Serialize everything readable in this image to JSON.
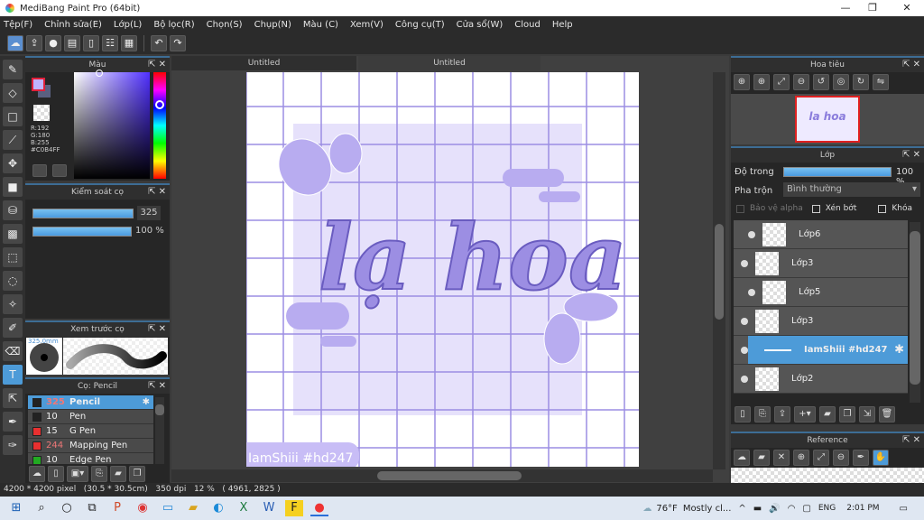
{
  "window": {
    "title": "MediBang Paint Pro (64bit)",
    "minimize": "—",
    "maximize": "❐",
    "close": "✕"
  },
  "menu": [
    "Tệp(F)",
    "Chỉnh sửa(E)",
    "Lớp(L)",
    "Bộ lọc(R)",
    "Chọn(S)",
    "Chụp(N)",
    "Màu (C)",
    "Xem(V)",
    "Công cụ(T)",
    "Cửa sổ(W)",
    "Cloud",
    "Help"
  ],
  "tabs": [
    "Untitled",
    "Untitled"
  ],
  "color_panel": {
    "title": "Màu",
    "r": "R:192",
    "g": "G:180",
    "b": "B:255",
    "hex": "#C0B4FF",
    "fg": "#c0b4ff",
    "bg": "#5a6080"
  },
  "brush_control": {
    "title": "Kiểm soát cọ",
    "size": "325",
    "opacity": "100 %"
  },
  "brush_preview": {
    "title": "Xem trước cọ",
    "size_label": "325.0mm"
  },
  "brush_list": {
    "title": "Cọ: Pencil",
    "items": [
      {
        "size": "325",
        "name": "Pencil",
        "color": "#222222",
        "selected": true
      },
      {
        "size": "10",
        "name": "Pen",
        "color": "#222222"
      },
      {
        "size": "15",
        "name": "G Pen",
        "color": "#e83030"
      },
      {
        "size": "244",
        "name": "Mapping Pen",
        "color": "#e83030"
      },
      {
        "size": "10",
        "name": "Edge Pen",
        "color": "#22aa22"
      }
    ]
  },
  "navigator": {
    "title": "Hoa tiêu"
  },
  "layers": {
    "title": "Lớp",
    "opacity_label": "Độ trong",
    "opacity": "100 %",
    "blend_label": "Pha trộn",
    "blend": "Bình thường",
    "protect_alpha": "Bảo vệ alpha",
    "clip": "Xén bớt",
    "lock": "Khóa",
    "items": [
      {
        "name": "Lớp6",
        "indent": true
      },
      {
        "name": "Lớp3"
      },
      {
        "name": "Lớp5",
        "indent": true
      },
      {
        "name": "Lớp3"
      },
      {
        "name": "IamShiii #hd247",
        "selected": true
      },
      {
        "name": "Lớp2"
      }
    ]
  },
  "reference": {
    "title": "Reference"
  },
  "canvas": {
    "art_text": "lạ hoa",
    "watermark": "IamShiii #hd247"
  },
  "status": "4200 * 4200 pixel   (30.5 * 30.5cm)   350 dpi   12 %   ( 4961, 2825 )",
  "taskbar": {
    "weather": "76°F",
    "weather_desc": "Mostly cl...",
    "lang": "ENG",
    "time": "2:01 PM"
  }
}
